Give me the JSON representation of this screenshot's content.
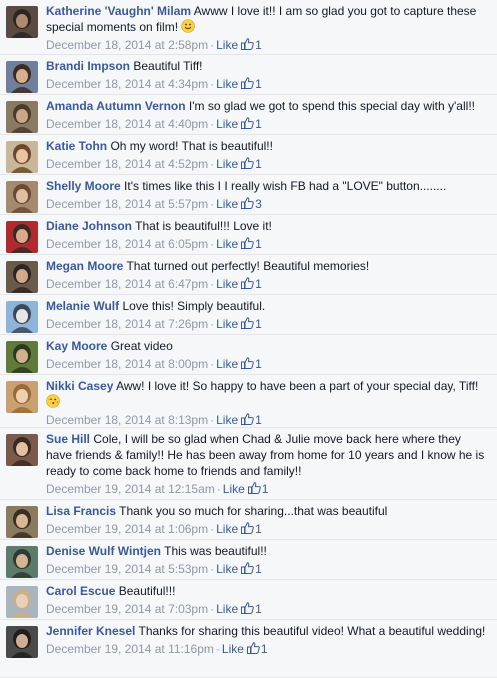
{
  "comments": [
    {
      "author": "Katherine 'Vaughn' Milam",
      "text": "Awww I love it!! I am so glad you got to capture these special moments on film!",
      "emoji": "smile",
      "timestamp": "December 18, 2014 at 2:58pm",
      "like_label": "Like",
      "separator": "·",
      "like_count": "1",
      "avatar_colors": [
        "#5a4a42",
        "#b08a6e",
        "#2b2624"
      ]
    },
    {
      "author": "Brandi Impson",
      "text": "Beautiful Tiff!",
      "emoji": "",
      "timestamp": "December 18, 2014 at 4:34pm",
      "like_label": "Like",
      "separator": "·",
      "like_count": "1",
      "avatar_colors": [
        "#6f7f9c",
        "#d9b08e",
        "#3c2c22"
      ]
    },
    {
      "author": "Amanda Autumn Vernon",
      "text": "I'm so glad we got to spend this special day with y'all!!",
      "emoji": "",
      "timestamp": "December 18, 2014 at 4:40pm",
      "like_label": "Like",
      "separator": "·",
      "like_count": "1",
      "avatar_colors": [
        "#8a7a63",
        "#c9a789",
        "#4a3b2a"
      ]
    },
    {
      "author": "Katie Tohn",
      "text": "Oh my word! That is beautiful!!",
      "emoji": "",
      "timestamp": "December 18, 2014 at 4:52pm",
      "like_label": "Like",
      "separator": "·",
      "like_count": "1",
      "avatar_colors": [
        "#c9b79a",
        "#e8c6a4",
        "#6b4a2b"
      ]
    },
    {
      "author": "Shelly Moore",
      "text": "It's times like this I I really wish FB had a \"LOVE\" button........",
      "emoji": "",
      "timestamp": "December 18, 2014 at 5:57pm",
      "like_label": "Like",
      "separator": "·",
      "like_count": "3",
      "avatar_colors": [
        "#a58a70",
        "#e0bfa0",
        "#6a4b33"
      ]
    },
    {
      "author": "Diane Johnson",
      "text": "That is beautiful!!! Love it!",
      "emoji": "",
      "timestamp": "December 18, 2014 at 6:05pm",
      "like_label": "Like",
      "separator": "·",
      "like_count": "1",
      "avatar_colors": [
        "#b02a30",
        "#d9a98a",
        "#3a2a25"
      ]
    },
    {
      "author": "Megan Moore",
      "text": "That turned out perfectly! Beautiful memories!",
      "emoji": "",
      "timestamp": "December 18, 2014 at 6:47pm",
      "like_label": "Like",
      "separator": "·",
      "like_count": "1",
      "avatar_colors": [
        "#6a5a4a",
        "#d1a98c",
        "#2e2622"
      ]
    },
    {
      "author": "Melanie Wulf",
      "text": "Love this! Simply beautiful.",
      "emoji": "",
      "timestamp": "December 18, 2014 at 7:26pm",
      "like_label": "Like",
      "separator": "·",
      "like_count": "1",
      "avatar_colors": [
        "#8fb4d9",
        "#e6e6e6",
        "#3a4a5a"
      ]
    },
    {
      "author": "Kay Moore",
      "text": "Great video",
      "emoji": "",
      "timestamp": "December 18, 2014 at 8:00pm",
      "like_label": "Like",
      "separator": "·",
      "like_count": "1",
      "avatar_colors": [
        "#5f7a3a",
        "#d2b08e",
        "#2e3a20"
      ]
    },
    {
      "author": "Nikki Casey",
      "text": "Aww! I love it! So happy to have been a part of your special day, Tiff!",
      "emoji": "kiss",
      "timestamp": "December 18, 2014 at 8:13pm",
      "like_label": "Like",
      "separator": "·",
      "like_count": "1",
      "avatar_colors": [
        "#c9a070",
        "#efcfae",
        "#9a6a3a"
      ]
    },
    {
      "author": "Sue Hill",
      "text": "Cole, I will be so glad when Chad & Julie move back here where they have friends & family!! He has been away from home for 10 years and I know he is ready to come back home to friends and family!!",
      "emoji": "",
      "timestamp": "December 19, 2014 at 12:15am",
      "like_label": "Like",
      "separator": "·",
      "like_count": "1",
      "avatar_colors": [
        "#7a5a4a",
        "#e2c0a2",
        "#3a2a22"
      ]
    },
    {
      "author": "Lisa Francis",
      "text": "Thank you so much for sharing...that was beautiful",
      "emoji": "",
      "timestamp": "December 19, 2014 at 1:06pm",
      "like_label": "Like",
      "separator": "·",
      "like_count": "1",
      "avatar_colors": [
        "#8a7a60",
        "#d8b896",
        "#3a2f22"
      ]
    },
    {
      "author": "Denise Wulf Wintjen",
      "text": "This was beautiful!!",
      "emoji": "",
      "timestamp": "December 19, 2014 at 5:53pm",
      "like_label": "Like",
      "separator": "·",
      "like_count": "1",
      "avatar_colors": [
        "#5e7a6a",
        "#d6b394",
        "#2e3a33"
      ]
    },
    {
      "author": "Carol Escue",
      "text": "Beautiful!!!",
      "emoji": "",
      "timestamp": "December 19, 2014 at 7:03pm",
      "like_label": "Like",
      "separator": "·",
      "like_count": "1",
      "avatar_colors": [
        "#a9b4bd",
        "#e8d0b8",
        "#c8b08a"
      ]
    },
    {
      "author": "Jennifer Knesel",
      "text": "Thanks for sharing this beautiful video! What a beautiful wedding!",
      "emoji": "",
      "timestamp": "December 19, 2014 at 11:16pm",
      "like_label": "Like",
      "separator": "·",
      "like_count": "1",
      "avatar_colors": [
        "#4a4a4a",
        "#cfae92",
        "#1e1e1e"
      ]
    }
  ],
  "colors": {
    "author": "#3b5998",
    "meta": "#9197a3",
    "background": "#f6f7f9"
  }
}
